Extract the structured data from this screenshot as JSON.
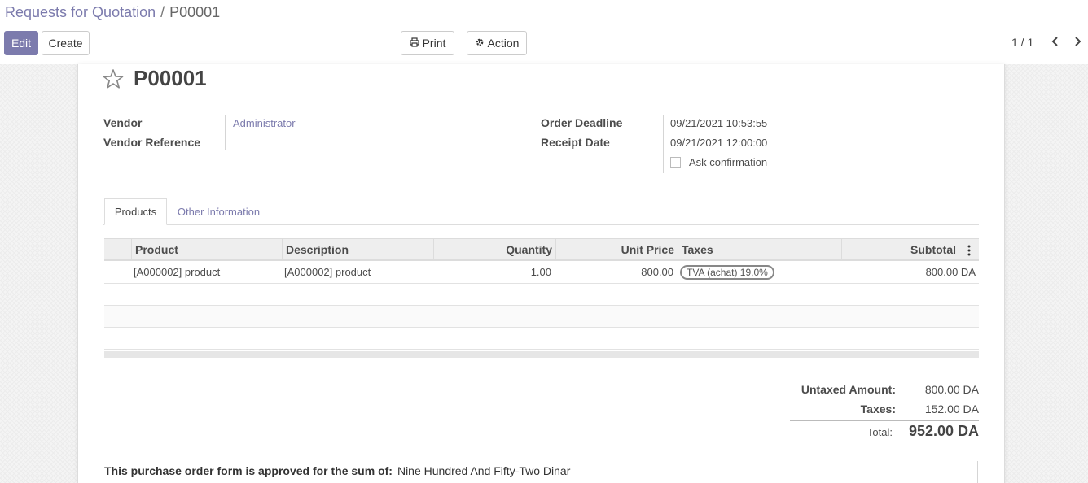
{
  "breadcrumb": {
    "parent": "Requests for Quotation",
    "separator": "/",
    "current": "P00001"
  },
  "toolbar": {
    "edit_label": "Edit",
    "create_label": "Create",
    "print_label": "Print",
    "action_label": "Action"
  },
  "pager": {
    "value": "1 / 1"
  },
  "record": {
    "title": "P00001"
  },
  "fields": {
    "vendor_label": "Vendor",
    "vendor_value": "Administrator",
    "vendor_reference_label": "Vendor Reference",
    "vendor_reference_value": "",
    "order_deadline_label": "Order Deadline",
    "order_deadline_value": "09/21/2021 10:53:55",
    "receipt_date_label": "Receipt Date",
    "receipt_date_value": "09/21/2021 12:00:00",
    "ask_confirmation_label": "Ask confirmation",
    "ask_confirmation_checked": false
  },
  "tabs": [
    {
      "label": "Products",
      "active": true
    },
    {
      "label": "Other Information",
      "active": false
    }
  ],
  "table": {
    "headers": {
      "product": "Product",
      "description": "Description",
      "quantity": "Quantity",
      "unit_price": "Unit Price",
      "taxes": "Taxes",
      "subtotal": "Subtotal"
    },
    "rows": [
      {
        "product": "[A000002] product",
        "description": "[A000002] product",
        "quantity": "1.00",
        "unit_price": "800.00",
        "taxes": "TVA (achat) 19,0%",
        "subtotal": "800.00 DA"
      }
    ]
  },
  "totals": {
    "untaxed_label": "Untaxed Amount:",
    "untaxed_value": "800.00 DA",
    "taxes_label": "Taxes:",
    "taxes_value": "152.00 DA",
    "total_label": "Total:",
    "total_value": "952.00 DA"
  },
  "approval": {
    "label": "This purchase order form is approved for the sum of:",
    "value": "Nine Hundred And Fifty-Two Dinar"
  },
  "colors": {
    "accent": "#7c7bad",
    "text": "#4c4c4c"
  }
}
